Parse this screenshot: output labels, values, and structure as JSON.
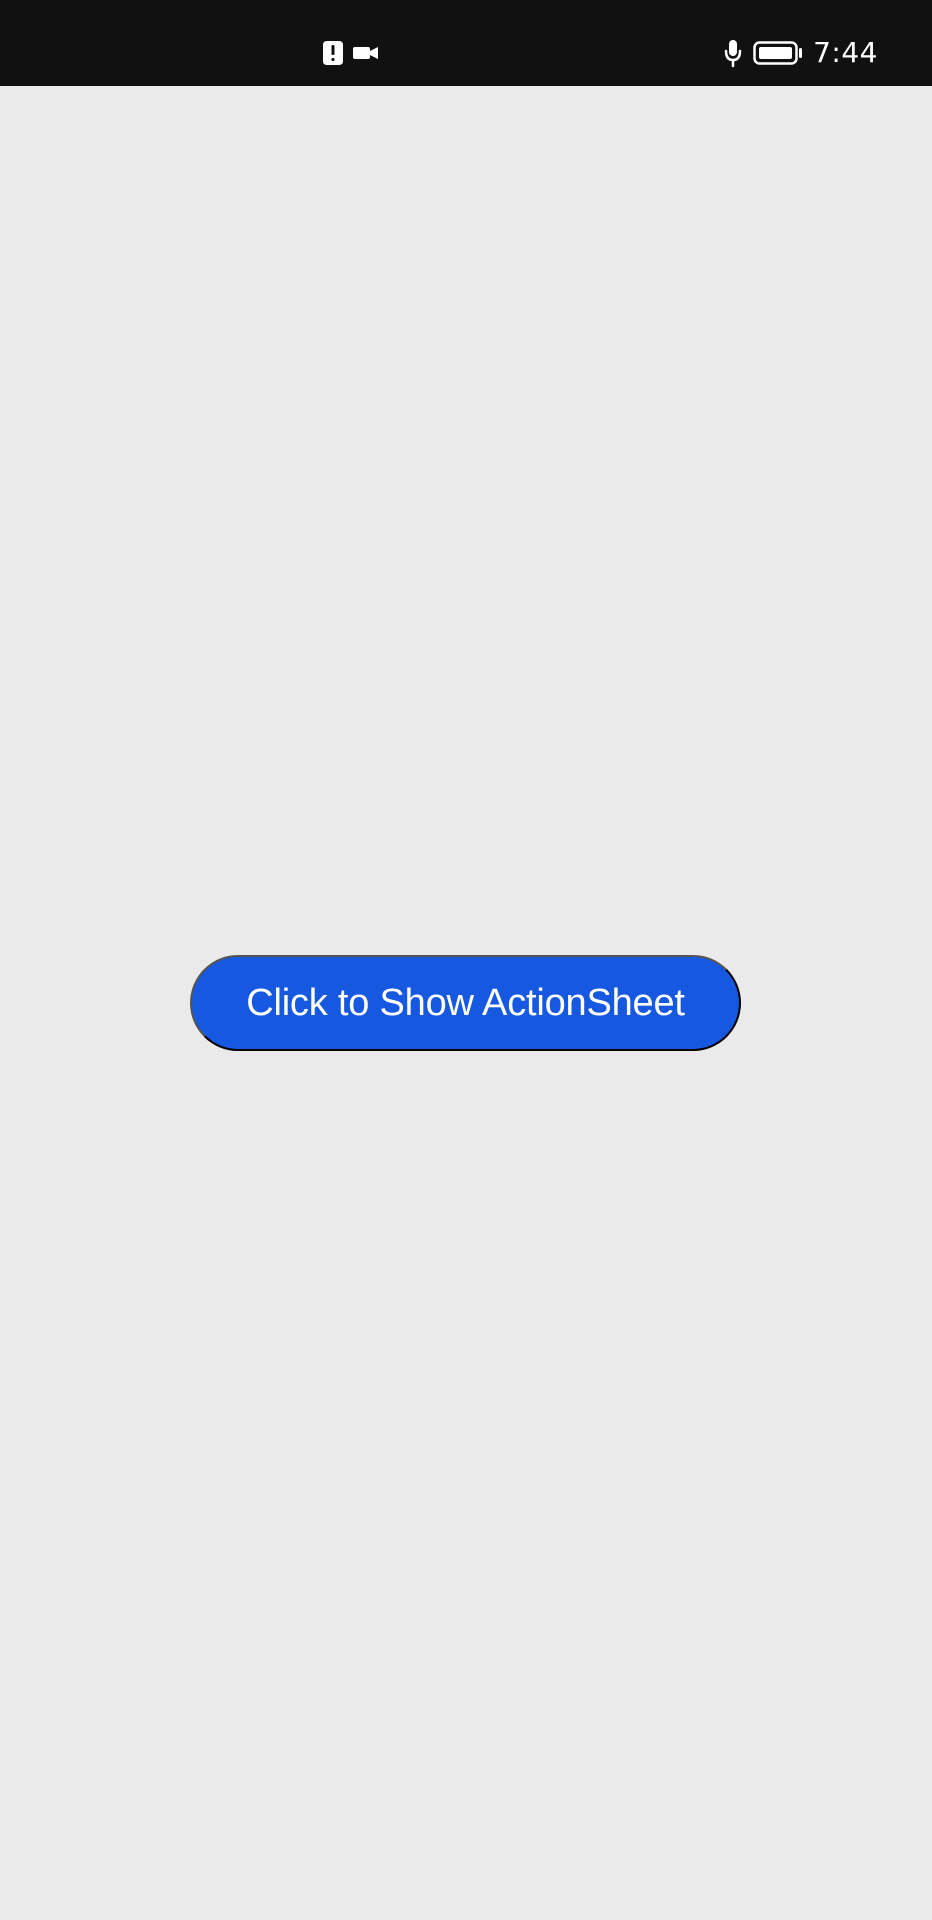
{
  "status_bar": {
    "time": "7:44",
    "left_icons": [
      "alert-icon",
      "video-camera-icon"
    ],
    "right_icons": [
      "microphone-icon",
      "battery-icon"
    ]
  },
  "main": {
    "button_label": "Click to Show ActionSheet"
  },
  "colors": {
    "status_bar_background": "#111111",
    "screen_background": "#eaeaeb",
    "button_background": "#1658e0",
    "button_text": "#ffffff"
  }
}
